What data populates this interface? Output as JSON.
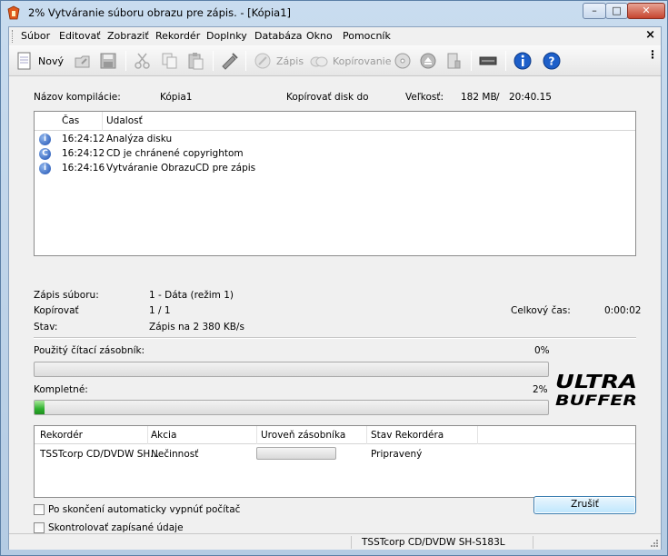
{
  "window": {
    "title": "2% Vytváranie súboru obrazu pre zápis. - [Kópia1]",
    "min_glyph": "–",
    "max_glyph": "□",
    "close_glyph": "✕"
  },
  "menu": {
    "items": [
      "Súbor",
      "Editovať",
      "Zobraziť",
      "Rekordér",
      "Doplnky",
      "Databáza",
      "Okno",
      "Pomocník"
    ],
    "close_glyph": "×"
  },
  "toolbar": {
    "new_label": "Nový",
    "write_label": "Zápis",
    "copy_label": "Kopírovanie",
    "more_glyph": "⋮"
  },
  "info": {
    "compilation_label": "Názov kompilácie:",
    "compilation_value": "Kópia1",
    "copy_disc_label": "Kopírovať disk do",
    "size_label": "Veľkosť:",
    "size_value": "182 MB",
    "size_sep": "/",
    "duration_value": "20:40.15"
  },
  "log": {
    "col_time": "Čas",
    "col_event": "Udalosť",
    "rows": [
      {
        "icon": "i",
        "icon_name": "info-icon",
        "time": "16:24:12",
        "event": "Analýza disku"
      },
      {
        "icon": "C",
        "icon_name": "copyright-icon",
        "time": "16:24:12",
        "event": "CD je chránené copyrightom"
      },
      {
        "icon": "i",
        "icon_name": "info-icon",
        "time": "16:24:16",
        "event": "Vytváranie ObrazuCD pre zápis"
      }
    ]
  },
  "status": {
    "write_file_label": "Zápis súboru:",
    "write_file_value": "1 - Dáta (režim 1)",
    "copy_label": "Kopírovať",
    "copy_value": "1 / 1",
    "state_label": "Stav:",
    "state_value": "Zápis na 2 380 KB/s",
    "total_time_label": "Celkový čas:",
    "total_time_value": "0:00:02"
  },
  "buffer": {
    "label": "Použitý čítací zásobník:",
    "percent_text": "0%",
    "fraction": 0.0
  },
  "complete": {
    "label": "Kompletné:",
    "percent_text": "2%",
    "fraction": 0.02
  },
  "logo_text": [
    "ULTRA",
    "BUFFER"
  ],
  "recorders": {
    "columns": [
      "Rekordér",
      "Akcia",
      "Uroveň zásobníka",
      "Stav Rekordéra"
    ],
    "rows": [
      {
        "recorder": "TSSTcorp CD/DVDW SH...",
        "action": "Nečinnosť",
        "buffer_fraction": 0.0,
        "state": "Pripravený"
      }
    ]
  },
  "options": {
    "auto_shutdown_label": "Po skončení automaticky vypnúť počítač",
    "verify_label": "Skontrolovať zapísané údaje"
  },
  "cancel_label": "Zrušiť",
  "statusbar_text": "TSSTcorp CD/DVDW SH-S183L",
  "colors": {
    "progress_green": "#2fb12f",
    "info_blue": "#1d4fb0"
  }
}
